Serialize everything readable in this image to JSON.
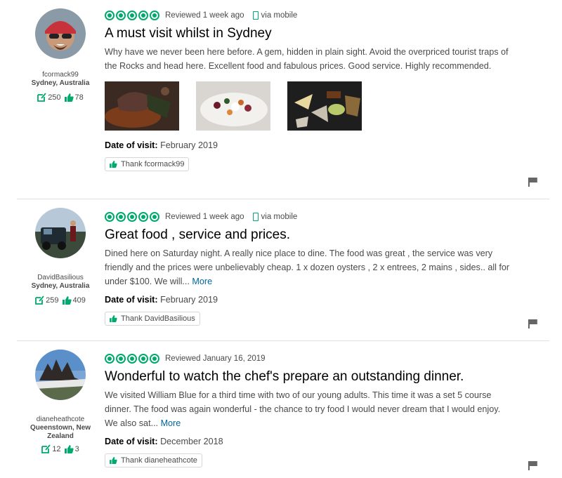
{
  "reviews": [
    {
      "username": "fcormack99",
      "location": "Sydney, Australia",
      "review_count": "250",
      "helpful_votes": "78",
      "rating": 5,
      "reviewed": "Reviewed 1 week ago",
      "via": "via mobile",
      "title": "A must visit whilst in Sydney",
      "body": "Why have we never been here before. A gem, hidden in plain sight. Avoid the overpriced tourist traps of the Rocks and head here. Excellent food and fabulous prices. Good service. Highly recommended.",
      "more": "",
      "date_label": "Date of visit:",
      "date_value": "February 2019",
      "thank_label": "Thank fcormack99"
    },
    {
      "username": "DavidBasilious",
      "location": "Sydney, Australia",
      "review_count": "259",
      "helpful_votes": "409",
      "rating": 5,
      "reviewed": "Reviewed 1 week ago",
      "via": "via mobile",
      "title": "Great food , service and prices.",
      "body": "Dined here on Saturday night. A really nice place to dine. The food was great , the service was very friendly and the prices were unbelievably cheap. 1 x dozen oysters , 2 x entrees, 2 mains , sides.. all for under $100. We will...",
      "more": "More",
      "date_label": "Date of visit:",
      "date_value": "February 2019",
      "thank_label": "Thank DavidBasilious"
    },
    {
      "username": "dianeheathcote",
      "location": "Queenstown, New Zealand",
      "review_count": "12",
      "helpful_votes": "3",
      "rating": 5,
      "reviewed": "Reviewed January 16, 2019",
      "via": "",
      "title": "Wonderful to watch the chef's prepare an outstanding dinner.",
      "body": "We visited William Blue for a third time with two of our young adults. This time it was a set 5 course dinner. The food was again wonderful - the chance to try food I would never dream that I would enjoy. We also sat...",
      "more": "More",
      "date_label": "Date of visit:",
      "date_value": "December 2018",
      "thank_label": "Thank dianeheathcote"
    }
  ],
  "colors": {
    "accent": "#00aa6c",
    "link": "#006699",
    "text": "#4a4a4a"
  },
  "icons": [
    "review-count-icon",
    "thumbs-up-icon",
    "rating-bubble-icon",
    "mobile-phone-icon",
    "flag-icon"
  ]
}
